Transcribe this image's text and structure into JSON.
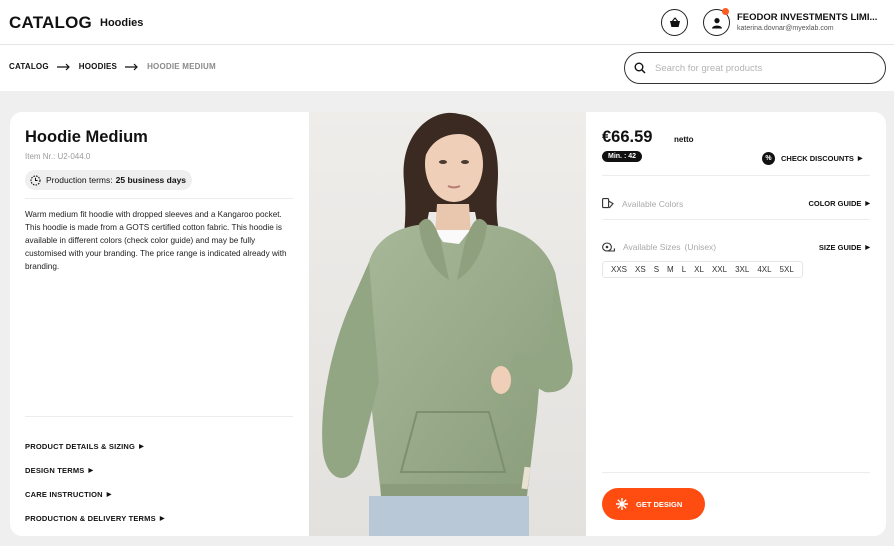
{
  "header": {
    "brand": "CATALOG",
    "section": "Hoodies",
    "company": "FEODOR INVESTMENTS LIMI...",
    "email": "katerina.dovnar@myexlab.com",
    "icons": [
      "basket-icon",
      "user-icon"
    ]
  },
  "breadcrumb": {
    "items": [
      "CATALOG",
      "HOODIES",
      "HOODIE MEDIUM"
    ]
  },
  "search": {
    "placeholder": "Search for great products",
    "value": ""
  },
  "product": {
    "title": "Hoodie Medium",
    "item_nr": "Item Nr.: U2-044.0",
    "production_label": "Production terms:",
    "production_value": "25 business days",
    "description": [
      "Warm medium fit hoodie with dropped sleeves and a Kangaroo pocket.",
      "This hoodie is made from a GOTS certified cotton fabric. This hoodie is available in different colors (check color guide) and may be fully customised with your branding. The price range is indicated already with branding."
    ],
    "links": [
      "PRODUCT DETAILS & SIZING",
      "DESIGN TERMS",
      "CARE INSTRUCTION",
      "PRODUCTION & DELIVERY TERMS"
    ]
  },
  "pricing": {
    "price": "€66.59",
    "netto": "netto",
    "min": "Min. : 42",
    "discounts": "CHECK DISCOUNTS",
    "colors_label": "Available Colors",
    "color_guide": "COLOR GUIDE",
    "sizes_label": "Available Sizes",
    "sizes_note": "(Unisex)",
    "size_guide": "SIZE GUIDE",
    "sizes": [
      "XXS",
      "XS",
      "S",
      "M",
      "L",
      "XL",
      "XXL",
      "3XL",
      "4XL",
      "5XL"
    ],
    "cta": "GET DESIGN"
  },
  "colors": {
    "accent": "#ff4d12",
    "hoodie": "#9cb08c",
    "dark": "#111111"
  }
}
